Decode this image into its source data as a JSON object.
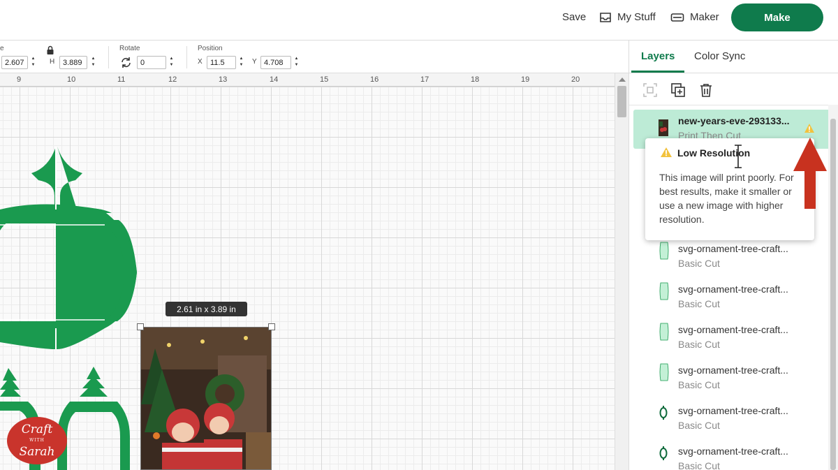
{
  "header": {
    "save_label": "Save",
    "mystuff_label": "My Stuff",
    "maker_label": "Maker",
    "make_label": "Make"
  },
  "toolbar": {
    "size_label_partial": "e",
    "width_value": "2.607",
    "height_letter": "H",
    "height_value": "3.889",
    "rotate_label": "Rotate",
    "rotate_value": "0",
    "position_label": "Position",
    "x_letter": "X",
    "x_value": "11.5",
    "y_letter": "Y",
    "y_value": "4.708"
  },
  "ruler": {
    "numbers": [
      "9",
      "10",
      "11",
      "12",
      "13",
      "14",
      "15",
      "16",
      "17",
      "18",
      "19",
      "20"
    ]
  },
  "canvas": {
    "size_tooltip": "2.61  in x 3.89  in"
  },
  "logo": {
    "line1": "Craft",
    "with": "WITH",
    "line2": "Sarah"
  },
  "panel": {
    "tabs": [
      {
        "label": "Layers",
        "active": true
      },
      {
        "label": "Color Sync",
        "active": false
      }
    ],
    "layers": [
      {
        "name": "new-years-eve-293133...",
        "type": "Print Then Cut",
        "selected": true
      },
      {
        "name": "svg-ornament-tree-craft...",
        "type": "Basic Cut"
      },
      {
        "name": "svg-ornament-tree-craft...",
        "type": "Basic Cut"
      },
      {
        "name": "svg-ornament-tree-craft...",
        "type": "Basic Cut"
      },
      {
        "name": "svg-ornament-tree-craft...",
        "type": "Basic Cut"
      },
      {
        "name": "svg-ornament-tree-craft...",
        "type": "Basic Cut"
      },
      {
        "name": "svg-ornament-tree-craft...",
        "type": "Basic Cut"
      }
    ]
  },
  "tooltip": {
    "title": "Low Resolution",
    "body": "This image will print poorly. For best results, make it smaller or use a new image with higher resolution."
  },
  "colors": {
    "brand_green": "#0f7b4c",
    "shape_green": "#1a9a4f",
    "warning_yellow": "#f2c23e",
    "arrow_red": "#c8321f",
    "logo_red": "#c9342c"
  }
}
